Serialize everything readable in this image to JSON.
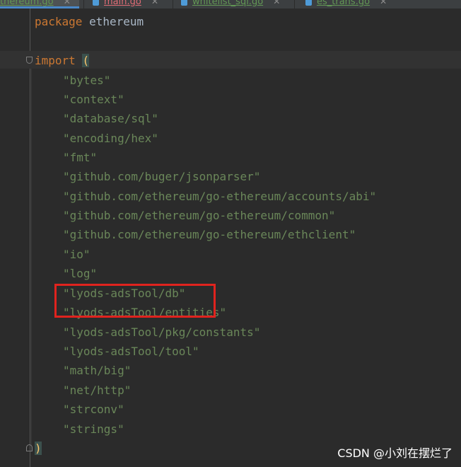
{
  "tabs": [
    {
      "label": "ethereum.go",
      "color": "#629755",
      "active": true
    },
    {
      "label": "main.go",
      "color": "#e06c75",
      "active": false
    },
    {
      "label": "whitelist_sql.go",
      "color": "#629755",
      "active": false
    },
    {
      "label": "es_trans.go",
      "color": "#629755",
      "active": false
    }
  ],
  "code": {
    "package_keyword": "package",
    "package_name": "ethereum",
    "import_keyword": "import",
    "open_paren": "(",
    "close_paren": ")",
    "imports": [
      "\"bytes\"",
      "\"context\"",
      "\"database/sql\"",
      "\"encoding/hex\"",
      "\"fmt\"",
      "\"github.com/buger/jsonparser\"",
      "\"github.com/ethereum/go-ethereum/accounts/abi\"",
      "\"github.com/ethereum/go-ethereum/common\"",
      "\"github.com/ethereum/go-ethereum/ethclient\"",
      "\"io\"",
      "\"log\"",
      "\"lyods-adsTool/db\"",
      "\"lyods-adsTool/entities\"",
      "\"lyods-adsTool/pkg/constants\"",
      "\"lyods-adsTool/tool\"",
      "\"math/big\"",
      "\"net/http\"",
      "\"strconv\"",
      "\"strings\""
    ]
  },
  "annotation": {
    "highlighted_import": "\"lyods-adsTool/db\"",
    "color": "#e0231e"
  },
  "watermark": "CSDN @小刘在摆烂了"
}
